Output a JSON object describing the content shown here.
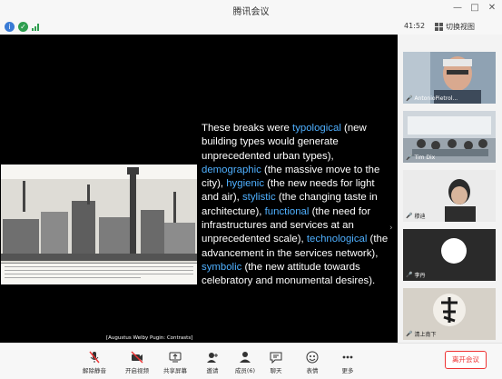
{
  "window": {
    "title": "腾讯会议"
  },
  "toolbar": {
    "timer": "41:52",
    "gallery_label": "切换视图"
  },
  "slide": {
    "segments": [
      {
        "text": "These breaks were ",
        "hl": false
      },
      {
        "text": "typological",
        "hl": true
      },
      {
        "text": " (new building types would generate unprecedented urban types), ",
        "hl": false
      },
      {
        "text": "demographic",
        "hl": true
      },
      {
        "text": " (the massive move to the city), ",
        "hl": false
      },
      {
        "text": "hygienic",
        "hl": true
      },
      {
        "text": " (the new needs for light and air), ",
        "hl": false
      },
      {
        "text": "stylistic",
        "hl": true
      },
      {
        "text": " (the changing taste in architecture), ",
        "hl": false
      },
      {
        "text": "functional",
        "hl": true
      },
      {
        "text": " (the need for infrastructures and services at an unprecedented scale), ",
        "hl": false
      },
      {
        "text": "technological",
        "hl": true
      },
      {
        "text": " (the advancement in the services network), ",
        "hl": false
      },
      {
        "text": "symbolic",
        "hl": true
      },
      {
        "text": " (the new attitude towards celebratory and monumental desires).",
        "hl": false
      }
    ],
    "caption": "[Augustus Welby Pugin: Contrasts]",
    "highlight_color": "#4fb0ff"
  },
  "participants": [
    {
      "name": "AntonioPietrol..."
    },
    {
      "name": "Tim Dix"
    },
    {
      "name": "穆迪"
    },
    {
      "name": "李丹"
    },
    {
      "name": "清上南下"
    }
  ],
  "bottom_bar": {
    "items": [
      {
        "label": "解除静音",
        "icon": "mic-muted-icon"
      },
      {
        "label": "开启视频",
        "icon": "camera-off-icon"
      },
      {
        "label": "共享屏幕",
        "icon": "share-screen-icon"
      },
      {
        "label": "邀请",
        "icon": "invite-icon"
      },
      {
        "label": "成员(6)",
        "icon": "members-icon"
      },
      {
        "label": "聊天",
        "icon": "chat-icon"
      },
      {
        "label": "表情",
        "icon": "emoji-icon"
      },
      {
        "label": "更多",
        "icon": "more-icon"
      }
    ],
    "leave_label": "离开会议"
  }
}
